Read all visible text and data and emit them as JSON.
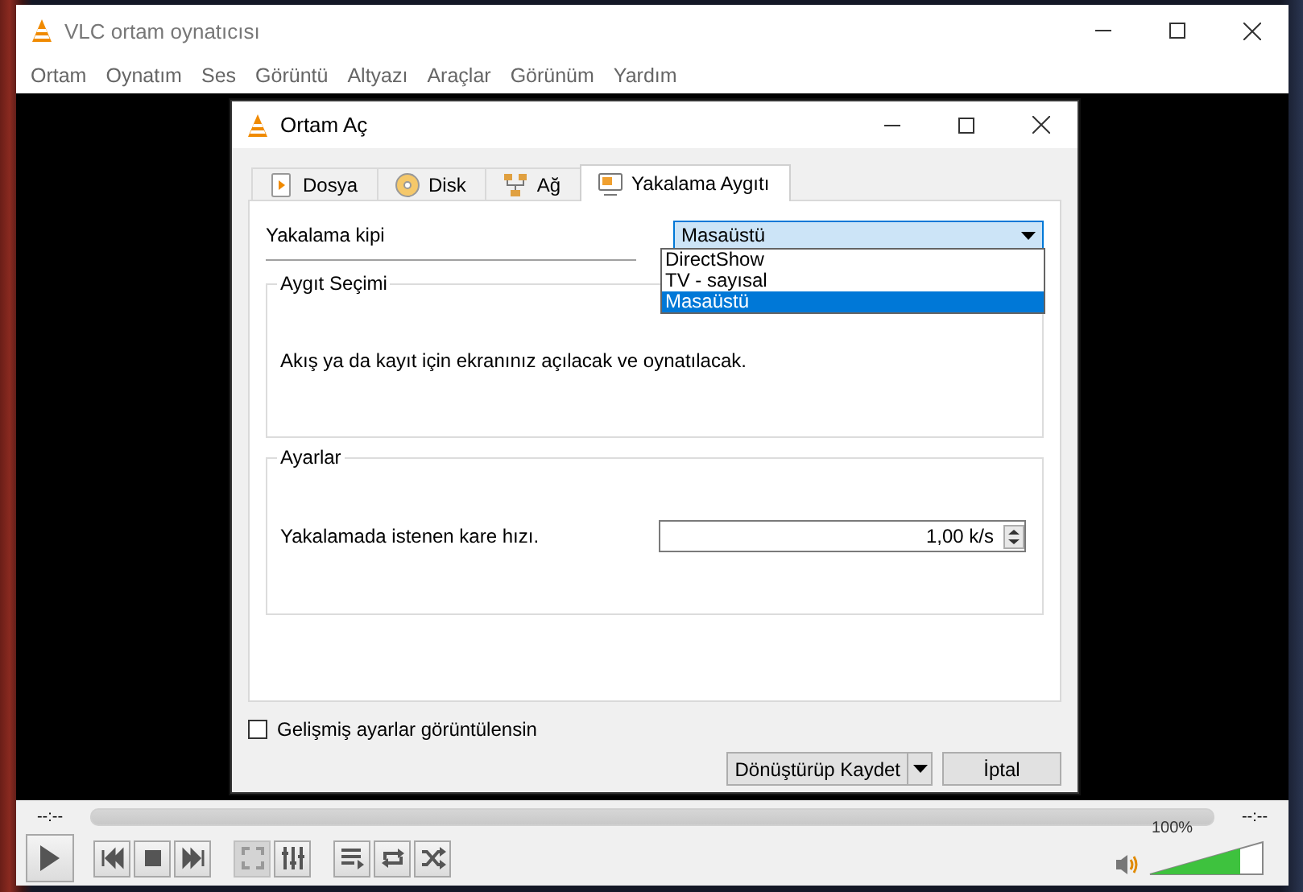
{
  "window": {
    "title": "VLC ortam oynatıcısı"
  },
  "menu": [
    "Ortam",
    "Oynatım",
    "Ses",
    "Görüntü",
    "Altyazı",
    "Araçlar",
    "Görünüm",
    "Yardım"
  ],
  "dialog": {
    "title": "Ortam Aç",
    "tabs": [
      {
        "label": "Dosya",
        "kind": "file",
        "selected": false
      },
      {
        "label": "Disk",
        "kind": "disc",
        "selected": false
      },
      {
        "label": "Ağ",
        "kind": "network",
        "selected": false
      },
      {
        "label": "Yakalama Aygıtı",
        "kind": "capture",
        "selected": true
      }
    ],
    "capture_mode": {
      "label": "Yakalama kipi",
      "value": "Masaüstü",
      "expanded": true,
      "options": [
        {
          "label": "DirectShow",
          "selected": false
        },
        {
          "label": "TV - sayısal",
          "selected": false
        },
        {
          "label": "Masaüstü",
          "selected": true
        }
      ]
    },
    "device_group": {
      "title": "Aygıt Seçimi",
      "text": "Akış ya da kayıt için ekranınız açılacak ve oynatılacak."
    },
    "settings_group": {
      "title": "Ayarlar",
      "label": "Yakalamada istenen kare hızı.",
      "value": "1,00 k/s"
    },
    "advanced": {
      "label": "Gelişmiş ayarlar görüntülensin",
      "checked": false
    },
    "buttons": [
      {
        "label": "Dönüştürüp Kaydet",
        "kind": "split"
      },
      {
        "label": "İptal",
        "kind": "plain"
      }
    ]
  },
  "player": {
    "elapsed": "--:--",
    "remaining": "--:--",
    "seek": {
      "level": 0
    },
    "controls": [
      {
        "kind": "play",
        "disabled": false
      },
      {
        "kind": "previous",
        "disabled": false
      },
      {
        "kind": "stop",
        "disabled": false
      },
      {
        "kind": "next",
        "disabled": false
      },
      {
        "kind": "fullscreen",
        "disabled": true
      },
      {
        "kind": "equalizer",
        "disabled": false
      },
      {
        "kind": "playlist",
        "disabled": false
      },
      {
        "kind": "loop",
        "disabled": false
      },
      {
        "kind": "shuffle",
        "disabled": false
      }
    ],
    "volume": {
      "reading": "100%",
      "level": 0.8
    }
  }
}
